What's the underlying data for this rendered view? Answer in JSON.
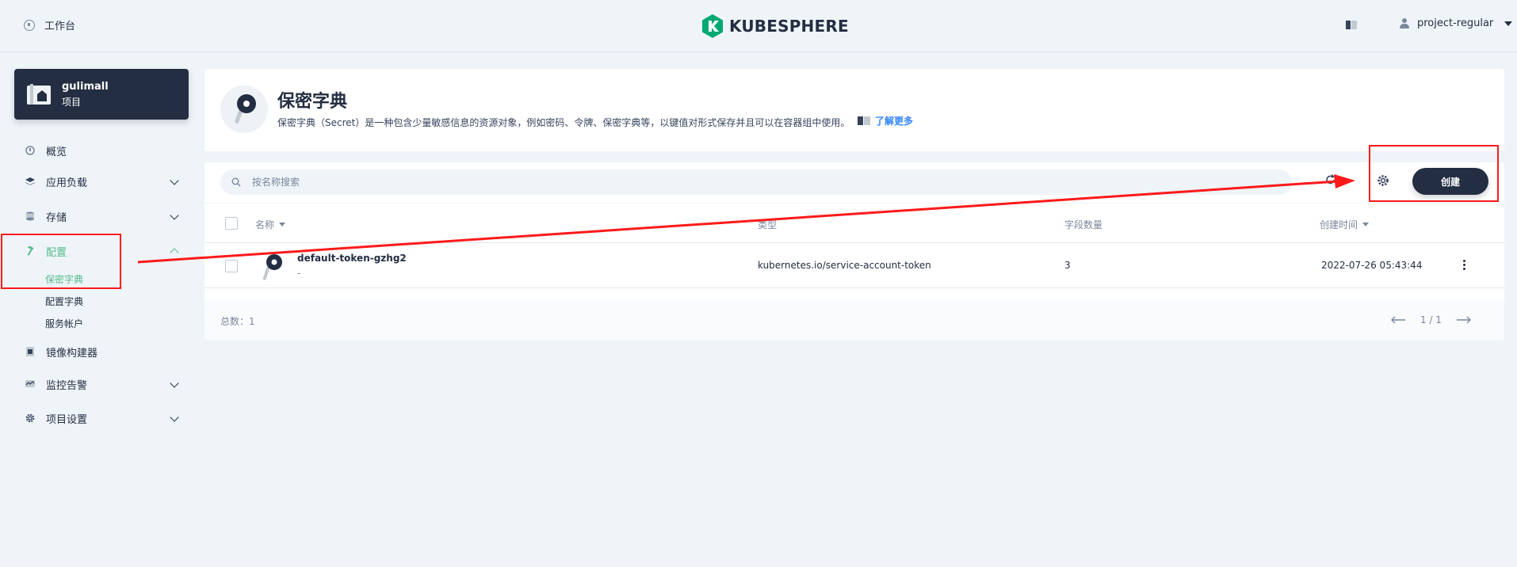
{
  "header": {
    "workbench_label": "工作台",
    "brand_name": "KUBESPHERE",
    "user_name": "project-regular",
    "brand_color": "#00a971"
  },
  "project": {
    "name": "gulimall",
    "type_label": "项目"
  },
  "sidebar": {
    "items": [
      {
        "label": "概览",
        "icon": "dashboard-icon"
      },
      {
        "label": "应用负载",
        "icon": "layers-icon"
      },
      {
        "label": "存储",
        "icon": "database-icon"
      },
      {
        "label": "配置",
        "icon": "hammer-icon"
      },
      {
        "label": "镜像构建器",
        "icon": "image-builder-icon"
      },
      {
        "label": "监控告警",
        "icon": "monitor-icon"
      },
      {
        "label": "项目设置",
        "icon": "gear-icon"
      }
    ],
    "config_sub": [
      {
        "label": "保密字典"
      },
      {
        "label": "配置字典"
      },
      {
        "label": "服务帐户"
      }
    ],
    "active_color": "#55bc8a"
  },
  "banner": {
    "title": "保密字典",
    "description": "保密字典（Secret）是一种包含少量敏感信息的资源对象，例如密码、令牌、保密字典等，以键值对形式保存并且可以在容器组中使用。",
    "learn_more": "了解更多"
  },
  "toolbar": {
    "search_placeholder": "按名称搜索",
    "create_label": "创建"
  },
  "table": {
    "columns": [
      "名称",
      "类型",
      "字段数量",
      "创建时间"
    ],
    "rows": [
      {
        "name": "default-token-gzhg2",
        "desc": "-",
        "type": "kubernetes.io/service-account-token",
        "field_count": "3",
        "created": "2022-07-26 05:43:44"
      }
    ]
  },
  "footer": {
    "total_label": "总数：1",
    "page": "1 / 1"
  },
  "annotation_color": "#ff1a1a"
}
